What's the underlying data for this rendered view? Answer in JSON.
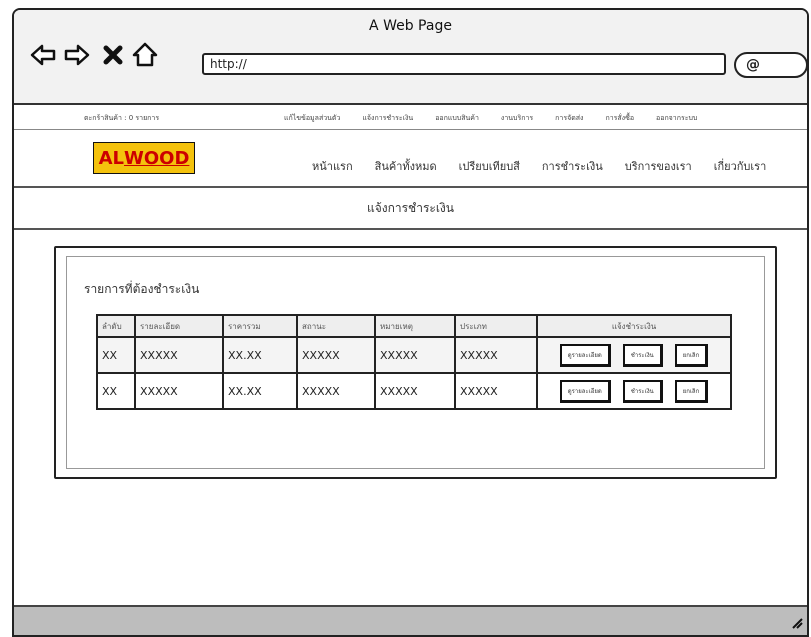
{
  "window": {
    "title": "A Web Page",
    "url": "http://"
  },
  "topbar": {
    "cart": "ตะกร้าสินค้า : 0 รายการ",
    "links": [
      "แก้ไขข้อมูลส่วนตัว",
      "แจ้งการชำระเงิน",
      "ออกแบบสินค้า",
      "งานบริการ",
      "การจัดส่ง",
      "การสั่งซื้อ",
      "ออกจากระบบ"
    ]
  },
  "brand": {
    "logo_a": "AL",
    "logo_b": "WOOD"
  },
  "nav": {
    "items": [
      "หน้าแรก",
      "สินค้าทั้งหมด",
      "เปรียบเทียบสี",
      "การชำระเงิน",
      "บริการของเรา",
      "เกี่ยวกับเรา"
    ]
  },
  "page": {
    "title": "แจ้งการชำระเงิน"
  },
  "card": {
    "title": "รายการที่ต้องชำระเงิน"
  },
  "table": {
    "headers": [
      "ลำดับ",
      "รายละเอียด",
      "ราคารวม",
      "สถานะ",
      "หมายเหตุ",
      "ประเภท",
      "แจ้งชำระเงิน"
    ],
    "rows": [
      [
        "XX",
        "XXXXX",
        "XX.XX",
        "XXXXX",
        "XXXXX",
        "XXXXX"
      ],
      [
        "XX",
        "XXXXX",
        "XX.XX",
        "XXXXX",
        "XXXXX",
        "XXXXX"
      ]
    ],
    "actions": [
      "ดูรายละเอียด",
      "ชำระเงิน",
      "ยกเลิก"
    ]
  }
}
